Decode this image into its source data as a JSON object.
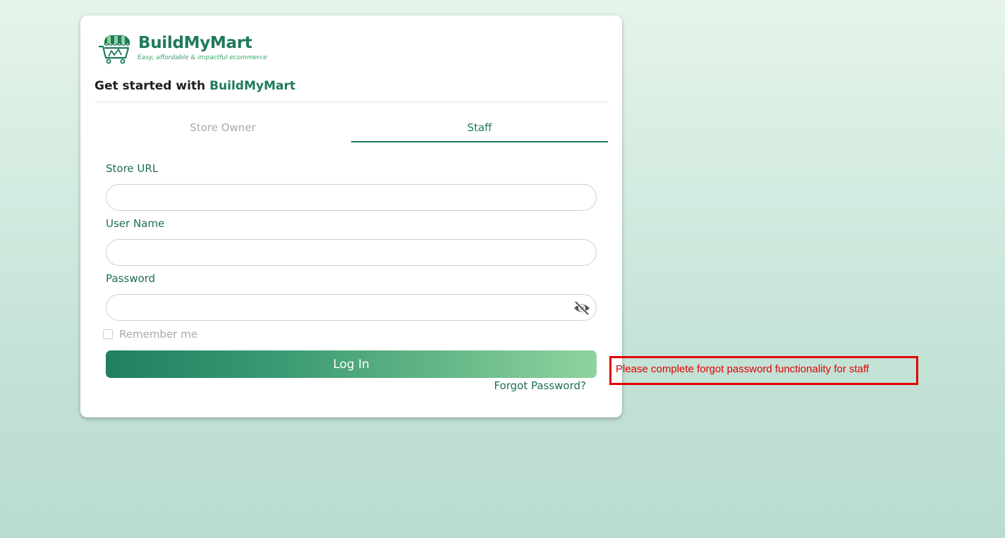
{
  "brand": {
    "name": "BuildMyMart",
    "tagline": "Easy, affordable & impactful ecommerce",
    "primary_color": "#1f7a5c",
    "accent_color": "#3aa36b",
    "logo_icon": "shopping-cart-awning-icon"
  },
  "heading": {
    "prefix": "Get started with",
    "brand": "BuildMyMart"
  },
  "tabs": [
    {
      "label": "Store Owner",
      "active": false
    },
    {
      "label": "Staff",
      "active": true
    }
  ],
  "form": {
    "store_url": {
      "label": "Store URL",
      "value": "",
      "placeholder": ""
    },
    "user_name": {
      "label": "User Name",
      "value": "",
      "placeholder": ""
    },
    "password": {
      "label": "Password",
      "value": "",
      "placeholder": "",
      "toggle_icon": "eye-slash-icon"
    },
    "remember": {
      "label": "Remember me",
      "checked": false
    },
    "login_label": "Log In",
    "forgot_label": "Forgot Password?"
  },
  "annotation": {
    "text": "Please complete forgot password functionality for staff",
    "color": "#e10000"
  }
}
